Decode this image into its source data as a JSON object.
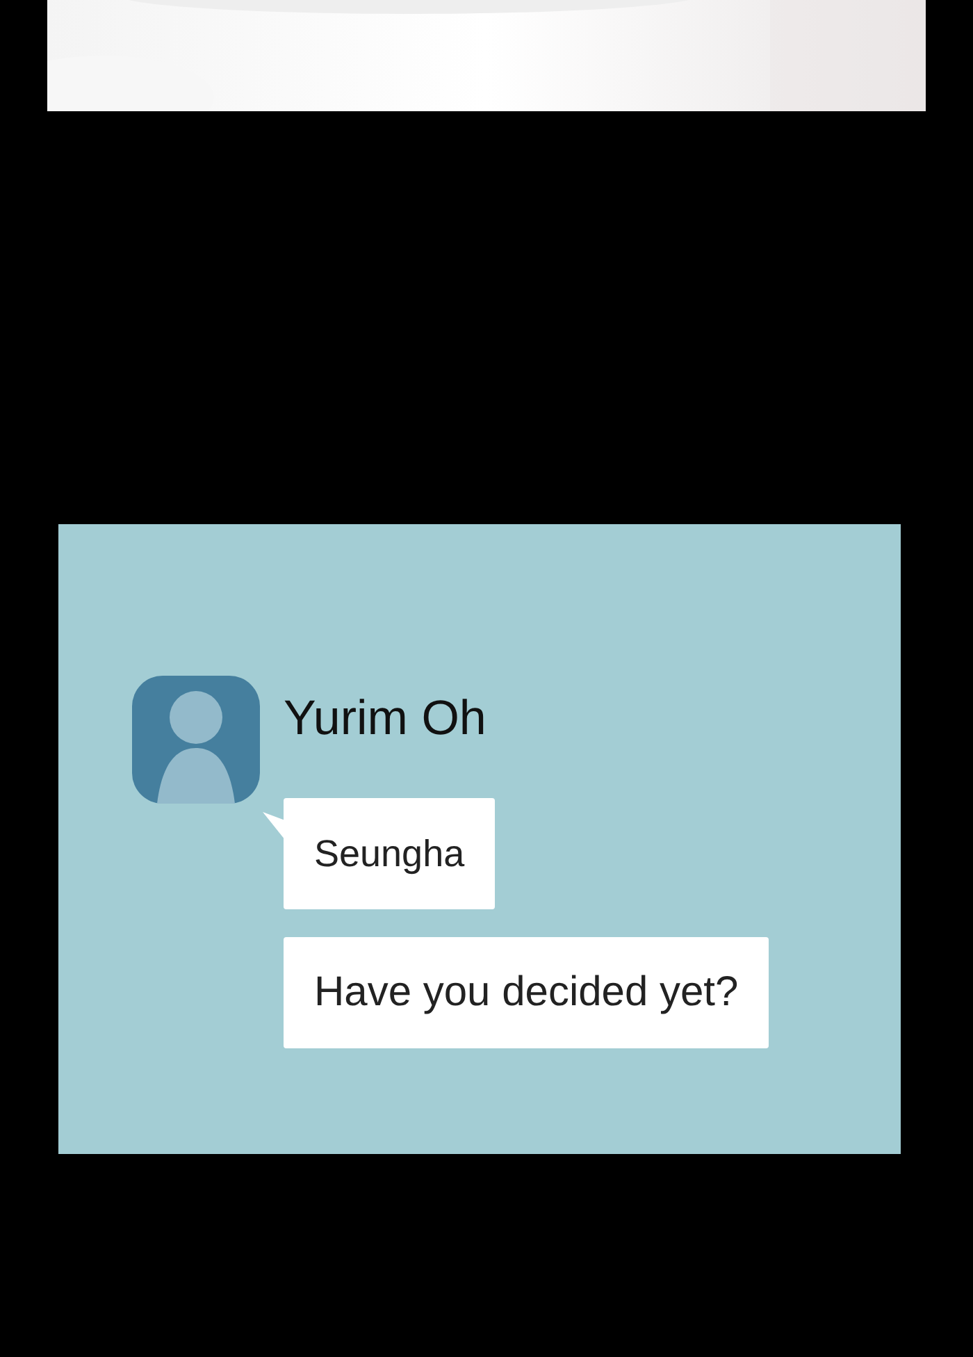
{
  "chat": {
    "sender": "Yurim Oh",
    "messages": [
      {
        "text": "Seungha",
        "first": true
      },
      {
        "text": "Have you decided yet?",
        "first": false
      }
    ]
  }
}
